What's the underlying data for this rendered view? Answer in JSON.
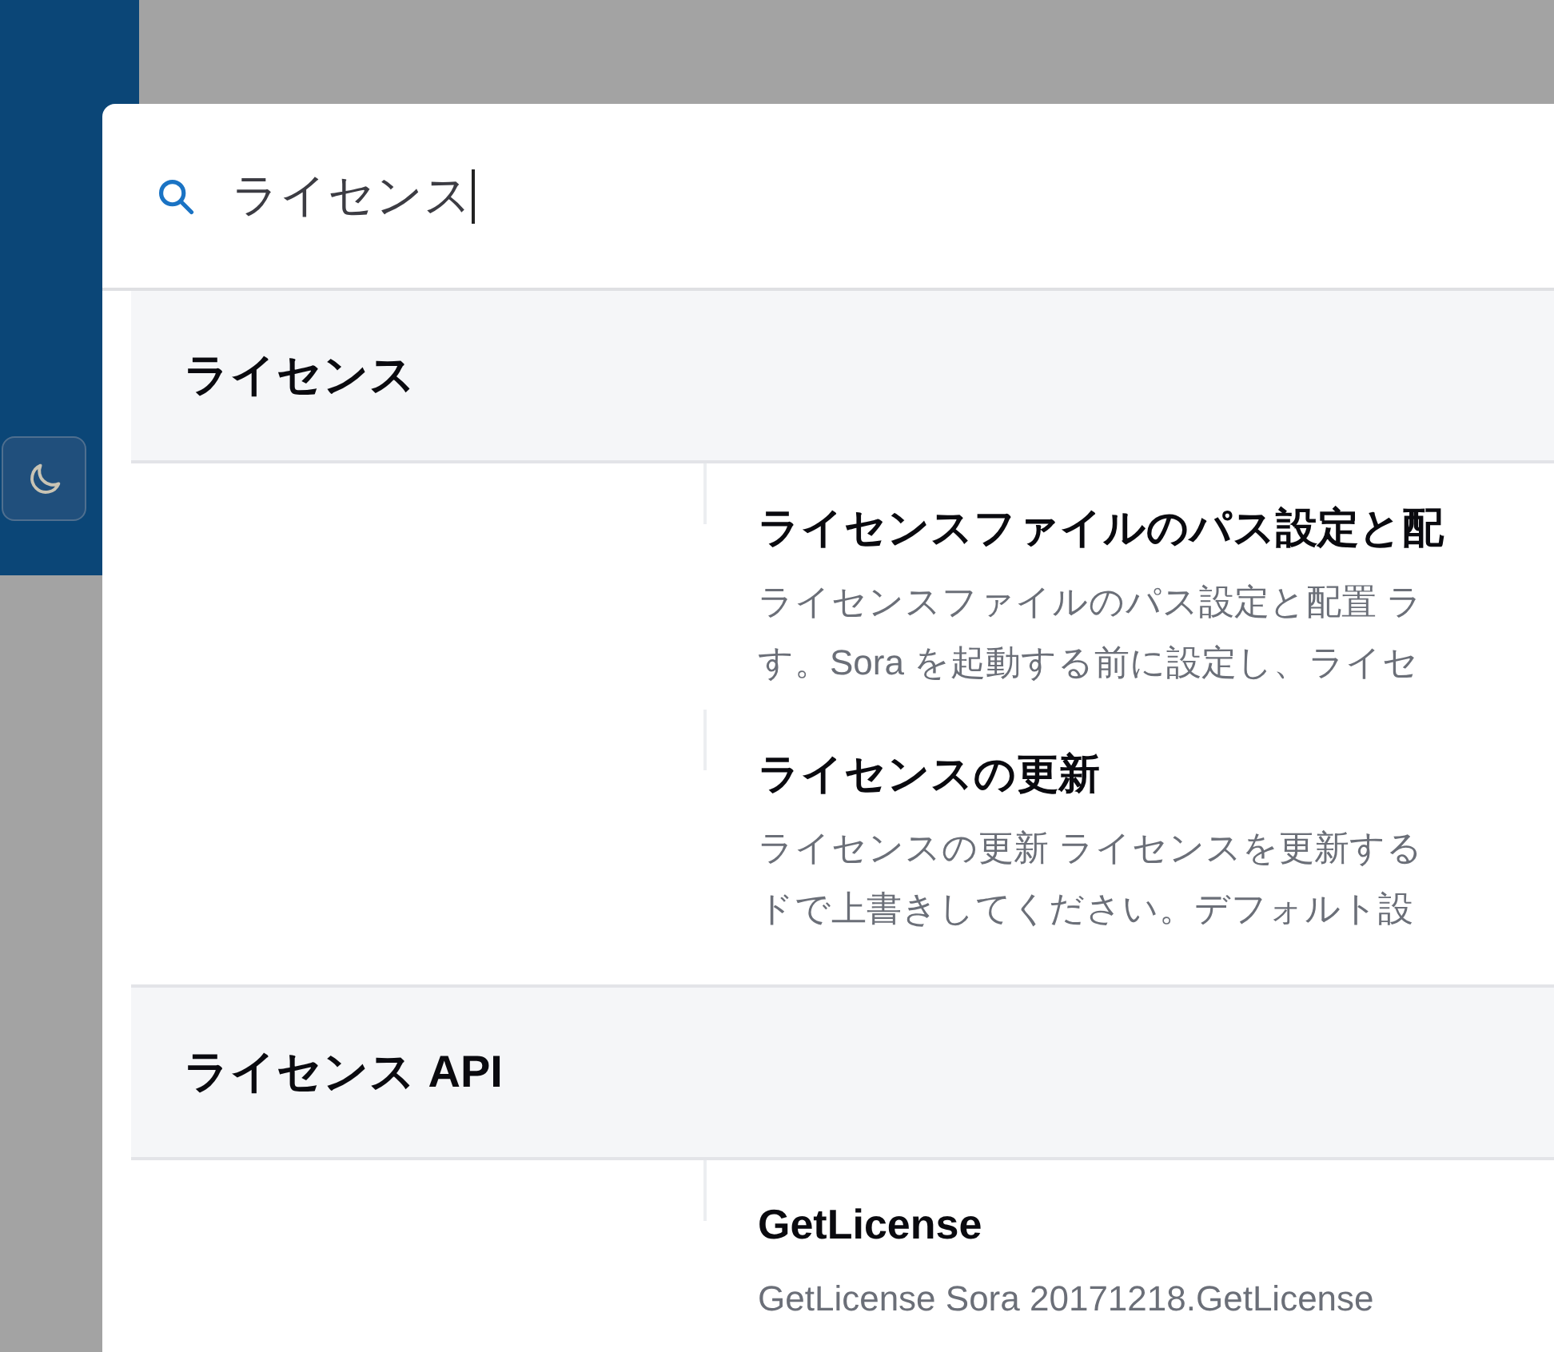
{
  "search": {
    "value": "ライセンス"
  },
  "sections": [
    {
      "title": "ライセンス",
      "hits": [
        {
          "title": "ライセンスファイルのパス設定と配",
          "lines": [
            "ライセンスファイルのパス設定と配置 ラ",
            "す。Sora を起動する前に設定し、ライセ"
          ]
        },
        {
          "title": "ライセンスの更新",
          "lines": [
            "ライセンスの更新 ライセンスを更新する",
            "ドで上書きしてください。デフォルト設"
          ]
        }
      ]
    },
    {
      "title": "ライセンス API",
      "hits": [
        {
          "title": "GetLicense",
          "lines": [
            "GetLicense Sora  20171218.GetLicense"
          ]
        }
      ]
    }
  ]
}
